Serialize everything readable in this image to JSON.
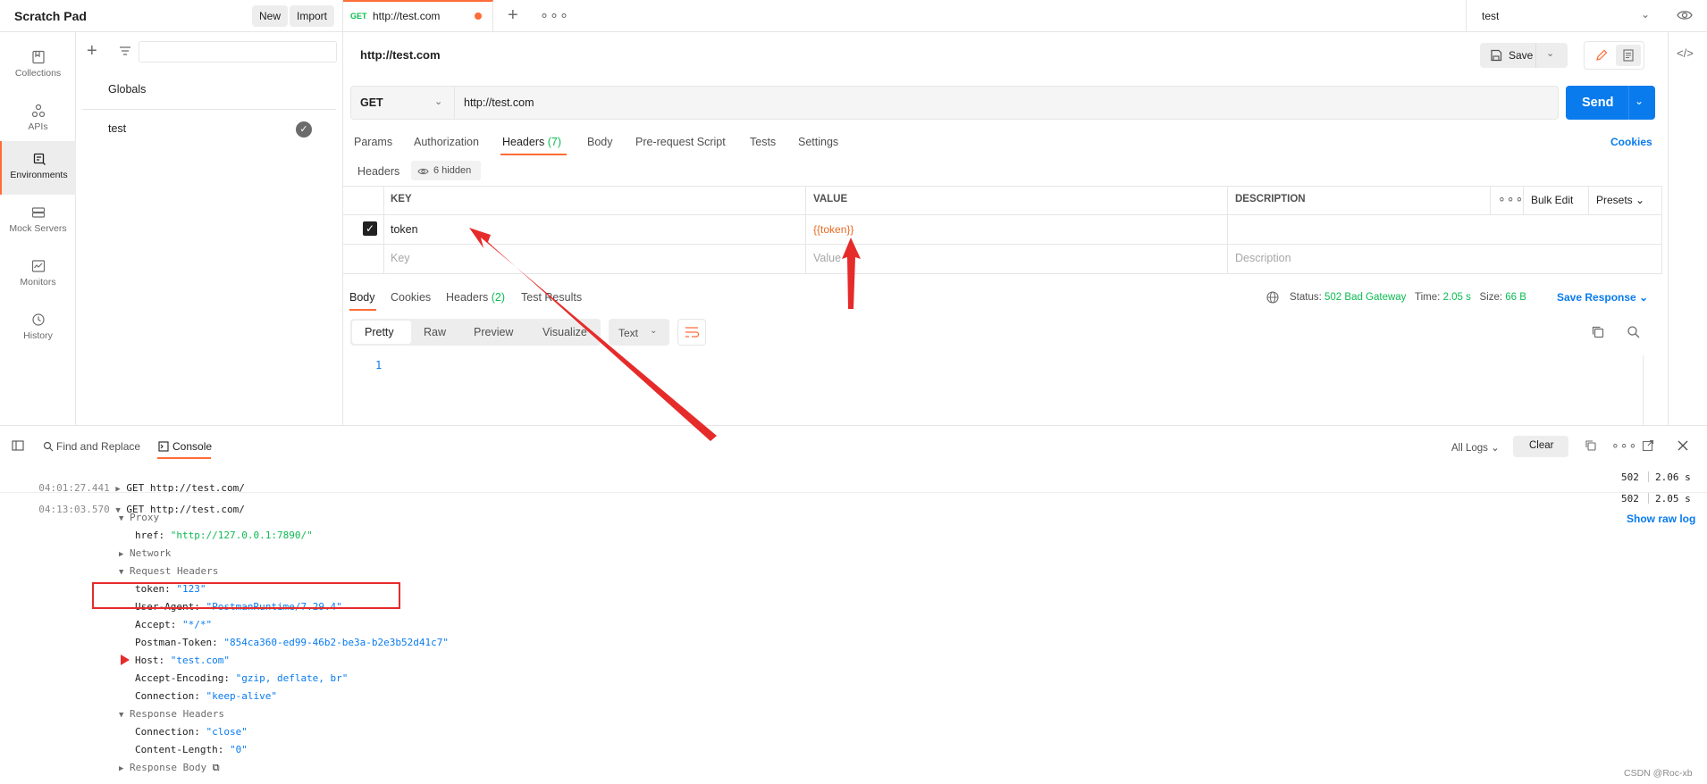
{
  "workspace": {
    "title": "Scratch Pad",
    "new_label": "New",
    "import_label": "Import"
  },
  "tabs": [
    {
      "method": "GET",
      "title": "http://test.com"
    }
  ],
  "environment_selector": {
    "selected": "test"
  },
  "rail": [
    {
      "label": "Collections",
      "icon": "collections-icon"
    },
    {
      "label": "APIs",
      "icon": "apis-icon"
    },
    {
      "label": "Environments",
      "icon": "environments-icon",
      "active": true
    },
    {
      "label": "Mock Servers",
      "icon": "mock-servers-icon"
    },
    {
      "label": "Monitors",
      "icon": "monitors-icon"
    },
    {
      "label": "History",
      "icon": "history-icon"
    }
  ],
  "env_list": {
    "search_placeholder": "",
    "items": [
      "Globals",
      "test"
    ]
  },
  "request": {
    "name": "http://test.com",
    "save_label": "Save",
    "method": "GET",
    "url": "http://test.com",
    "send_label": "Send",
    "tabs": {
      "params": "Params",
      "authorization": "Authorization",
      "headers": "Headers",
      "headers_count": "(7)",
      "body": "Body",
      "prerequest": "Pre-request Script",
      "tests": "Tests",
      "settings": "Settings"
    },
    "cookies_label": "Cookies",
    "headers_subtitle": "Headers",
    "hidden_label": "6 hidden",
    "table": {
      "columns": [
        "KEY",
        "VALUE",
        "DESCRIPTION"
      ],
      "bulk_edit": "Bulk Edit",
      "presets": "Presets",
      "rows": [
        {
          "checked": true,
          "key": "token",
          "value": "{{token}}",
          "description": ""
        }
      ],
      "placeholder": {
        "key": "Key",
        "value": "Value",
        "description": "Description"
      }
    }
  },
  "response": {
    "tabs": {
      "body": "Body",
      "cookies": "Cookies",
      "headers": "Headers",
      "headers_count": "(2)",
      "test_results": "Test Results"
    },
    "status_label": "Status:",
    "status_value": "502 Bad Gateway",
    "time_label": "Time:",
    "time_value": "2.05 s",
    "size_label": "Size:",
    "size_value": "66 B",
    "save_response": "Save Response",
    "formats": [
      "Pretty",
      "Raw",
      "Preview",
      "Visualize"
    ],
    "text_select": "Text",
    "line_number": "1"
  },
  "console": {
    "find_replace": "Find and Replace",
    "console_label": "Console",
    "all_logs": "All Logs",
    "clear_label": "Clear",
    "show_raw_log": "Show raw log",
    "entries": [
      {
        "time": "04:01:27.441",
        "request": "GET http://test.com/",
        "status": "502",
        "duration": "2.06 s"
      },
      {
        "time": "04:13:03.570",
        "request": "GET http://test.com/",
        "status": "502",
        "duration": "2.05 s"
      }
    ],
    "detail": {
      "proxy": "Proxy",
      "href_key": "href:",
      "href_val": "\"http://127.0.0.1:7890/\"",
      "network": "Network",
      "request_headers": "Request Headers",
      "req_headers": [
        {
          "k": "token:",
          "v": "\"123\""
        },
        {
          "k": "User-Agent:",
          "v": "\"PostmanRuntime/7.29.4\""
        },
        {
          "k": "Accept:",
          "v": "\"*/*\""
        },
        {
          "k": "Postman-Token:",
          "v": "\"854ca360-ed99-46b2-be3a-b2e3b52d41c7\""
        },
        {
          "k": "Host:",
          "v": "\"test.com\""
        },
        {
          "k": "Accept-Encoding:",
          "v": "\"gzip, deflate, br\""
        },
        {
          "k": "Connection:",
          "v": "\"keep-alive\""
        }
      ],
      "response_headers": "Response Headers",
      "resp_headers": [
        {
          "k": "Connection:",
          "v": "\"close\""
        },
        {
          "k": "Content-Length:",
          "v": "\"0\""
        }
      ],
      "response_body": "Response Body"
    }
  },
  "watermark": "CSDN @Roc-xb",
  "colors": {
    "accent": "#ff6c37",
    "primary": "#097bed",
    "success": "#0cbb52",
    "annotation": "#e62b2b"
  }
}
